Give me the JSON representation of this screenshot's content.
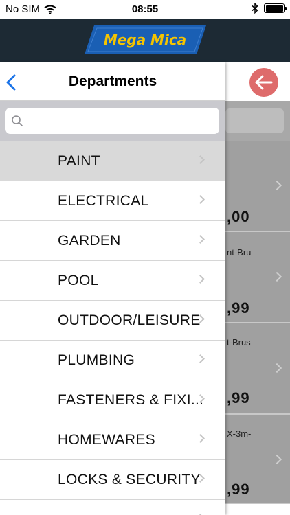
{
  "status_bar": {
    "carrier": "No SIM",
    "time": "08:55"
  },
  "header": {
    "logo_text": "Mega Mica",
    "brand_colors": {
      "bar": "#1d2a34",
      "logo_bg": "#1a5fb4",
      "logo_text": "#f5c400"
    }
  },
  "drawer": {
    "title": "Departments",
    "search_placeholder": "",
    "items": [
      {
        "label": "PAINT",
        "selected": true
      },
      {
        "label": "ELECTRICAL"
      },
      {
        "label": "GARDEN"
      },
      {
        "label": "POOL"
      },
      {
        "label": "OUTDOOR/LEISURE"
      },
      {
        "label": "PLUMBING"
      },
      {
        "label": "FASTENERS & FIXI..."
      },
      {
        "label": "HOMEWARES"
      },
      {
        "label": "LOCKS & SECURITY"
      }
    ]
  },
  "background_products": [
    {
      "name": "",
      "price": ",00"
    },
    {
      "name": "nt-Bru",
      "price": ",99"
    },
    {
      "name": "t-Brus",
      "price": ",99"
    },
    {
      "name": "X-3m-",
      "price": ",99"
    }
  ],
  "icons": {
    "back": "chevron-left-icon",
    "search": "search-icon",
    "return": "arrow-left-icon",
    "wifi": "wifi-icon",
    "bluetooth": "bluetooth-icon",
    "battery": "battery-icon"
  }
}
